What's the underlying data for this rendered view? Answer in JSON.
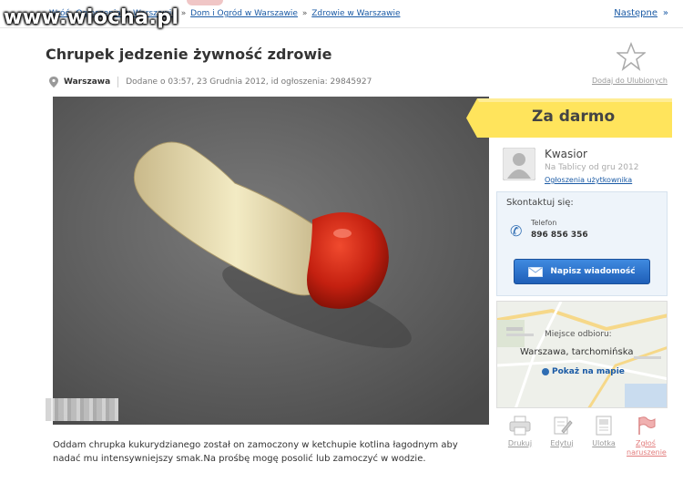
{
  "watermark": "www.wiocha.pl",
  "breadcrumb": {
    "back": "Wróć",
    "items": [
      "Ogłoszenia w Warszawie",
      "Dom i Ogród w Warszawie",
      "Zdrowie w Warszawie"
    ],
    "separator": "»"
  },
  "nav": {
    "next": "Następne",
    "next_arrow": "»"
  },
  "listing": {
    "title": "Chrupek jedzenie żywność zdrowie",
    "city": "Warszawa",
    "posted": "Dodane o 03:57, 23 Grudnia 2012, id ogłoszenia: 29845927",
    "add_to_favorites": "Dodaj do Ulubionych",
    "price": "Za darmo",
    "description": "Oddam chrupka kukurydzianego został on zamoczony w ketchupie kotlina łagodnym aby nadać mu intensywniejszy smak.Na prośbę mogę posolić lub zamoczyć w wodzie."
  },
  "seller": {
    "name": "Kwasior",
    "since": "Na Tablicy od gru 2012",
    "ads_link": "Ogłoszenia użytkownika"
  },
  "contact": {
    "label": "Skontaktuj się:",
    "phone_label": "Telefon",
    "phone_number": "896 856 356",
    "message_button": "Napisz wiadomość"
  },
  "map": {
    "pickup_label": "Miejsce odbioru:",
    "place": "Warszawa, tarchomińska",
    "show_link": "Pokaż na mapie"
  },
  "tools": [
    {
      "label": "Drukuj",
      "icon": "printer-icon"
    },
    {
      "label": "Edytuj",
      "icon": "edit-icon"
    },
    {
      "label": "Ulotka",
      "icon": "flyer-icon"
    },
    {
      "label": "Zgłoś naruszenie",
      "icon": "flag-icon"
    }
  ],
  "colors": {
    "link": "#1a5aa5",
    "price_badge": "#ffe45c",
    "message_button": "#2f6db3",
    "photo_background": "#5e5e5e",
    "ketchup": "#c42010"
  }
}
